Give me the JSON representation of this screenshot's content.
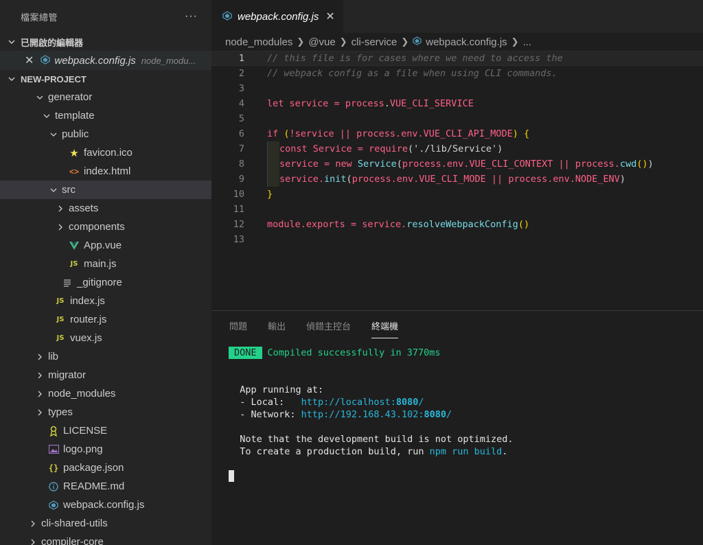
{
  "sidebar": {
    "title": "檔案總管",
    "more": "···",
    "open_editors_label": "已開啟的編輯器",
    "open_editor": {
      "close": "✕",
      "name": "webpack.config.js",
      "path": "node_modu..."
    },
    "project_label": "NEW-PROJECT",
    "tree": [
      {
        "label": "generator",
        "type": "folder-open",
        "depth": 0
      },
      {
        "label": "template",
        "type": "folder-open",
        "depth": 1
      },
      {
        "label": "public",
        "type": "folder-open",
        "depth": 2
      },
      {
        "label": "favicon.ico",
        "type": "file",
        "icon": "star-icon",
        "depth": 3
      },
      {
        "label": "index.html",
        "type": "file",
        "icon": "html-icon",
        "depth": 3
      },
      {
        "label": "src",
        "type": "folder-open",
        "depth": 2,
        "selected": true
      },
      {
        "label": "assets",
        "type": "folder-closed",
        "depth": 3
      },
      {
        "label": "components",
        "type": "folder-closed",
        "depth": 3
      },
      {
        "label": "App.vue",
        "type": "file",
        "icon": "vue-icon",
        "depth": 3
      },
      {
        "label": "main.js",
        "type": "file",
        "icon": "js-icon",
        "depth": 3
      },
      {
        "label": "_gitignore",
        "type": "file",
        "icon": "lines-icon",
        "depth": 2
      },
      {
        "label": "index.js",
        "type": "file",
        "icon": "js-icon",
        "depth": 1
      },
      {
        "label": "router.js",
        "type": "file",
        "icon": "js-icon",
        "depth": 1
      },
      {
        "label": "vuex.js",
        "type": "file",
        "icon": "js-icon",
        "depth": 1
      },
      {
        "label": "lib",
        "type": "folder-closed",
        "depth": 0
      },
      {
        "label": "migrator",
        "type": "folder-closed",
        "depth": 0
      },
      {
        "label": "node_modules",
        "type": "folder-closed",
        "depth": 0
      },
      {
        "label": "types",
        "type": "folder-closed",
        "depth": 0
      },
      {
        "label": "LICENSE",
        "type": "file",
        "icon": "license-icon",
        "depth": 0
      },
      {
        "label": "logo.png",
        "type": "file",
        "icon": "image-icon",
        "depth": 0
      },
      {
        "label": "package.json",
        "type": "file",
        "icon": "json-icon",
        "depth": 0
      },
      {
        "label": "README.md",
        "type": "file",
        "icon": "info-icon",
        "depth": 0
      },
      {
        "label": "webpack.config.js",
        "type": "file",
        "icon": "webpack-icon",
        "depth": 0
      },
      {
        "label": "cli-shared-utils",
        "type": "folder-closed",
        "depth": -1
      },
      {
        "label": "compiler-core",
        "type": "folder-closed",
        "depth": -1
      }
    ]
  },
  "editor": {
    "tab": {
      "label": "webpack.config.js",
      "close": "✕"
    },
    "breadcrumb": [
      "node_modules",
      "@vue",
      "cli-service",
      "webpack.config.js",
      "..."
    ],
    "line_numbers": [
      "1",
      "2",
      "3",
      "4",
      "5",
      "6",
      "7",
      "8",
      "9",
      "10",
      "11",
      "12",
      "13"
    ],
    "code": {
      "l1": "// this file is for cases where we need to access the",
      "l2": "// webpack config as a file when using CLI commands.",
      "l4a": "let",
      "l4b": "service",
      "l4c": "=",
      "l4d": "process",
      "l4e": ".",
      "l4f": "VUE_CLI_SERVICE",
      "l6a": "if",
      "l6b": "(",
      "l6c": "!service",
      "l6d": "||",
      "l6e": "process.env.VUE_CLI_API_MODE",
      "l6f": ")",
      "l6g": "{",
      "l7a": "const",
      "l7b": "Service",
      "l7c": "=",
      "l7d": "require",
      "l7e": "(",
      "l7f": "'./lib/Service'",
      "l7g": ")",
      "l8a": "service",
      "l8b": "=",
      "l8c": "new",
      "l8d": "Service",
      "l8e": "(",
      "l8f": "process.env.VUE_CLI_CONTEXT",
      "l8g": "||",
      "l8h": "process.",
      "l8i": "cwd",
      "l8j": "()",
      "l8k": ")",
      "l9a": "service.",
      "l9b": "init",
      "l9c": "(",
      "l9d": "process.env.VUE_CLI_MODE",
      "l9e": "||",
      "l9f": "process.env.NODE_ENV",
      "l9g": ")",
      "l10a": "}",
      "l12a": "module.exports",
      "l12b": "=",
      "l12c": "service.",
      "l12d": "resolveWebpackConfig",
      "l12e": "()"
    }
  },
  "panel": {
    "tabs": [
      "問題",
      "輸出",
      "偵錯主控台",
      "終端機"
    ],
    "active_tab": "終端機",
    "terminal": {
      "done": "DONE",
      "compiled": "Compiled successfully in 3770ms",
      "running": "App running at:",
      "local_label": "- Local:   ",
      "local_url_a": "http://localhost:",
      "local_port": "8080",
      "local_slash": "/",
      "network_label": "- Network: ",
      "network_url_a": "http://192.168.43.102:",
      "network_port": "8080",
      "network_slash": "/",
      "note1": "Note that the development build is not optimized.",
      "note2a": "To create a production build, run ",
      "note2b": "npm run build",
      "note2c": "."
    }
  },
  "colors": {
    "sidebar_bg": "#252526",
    "editor_bg": "#1e1e1e",
    "done_badge": "#23d18b",
    "link": "#29b8db"
  }
}
